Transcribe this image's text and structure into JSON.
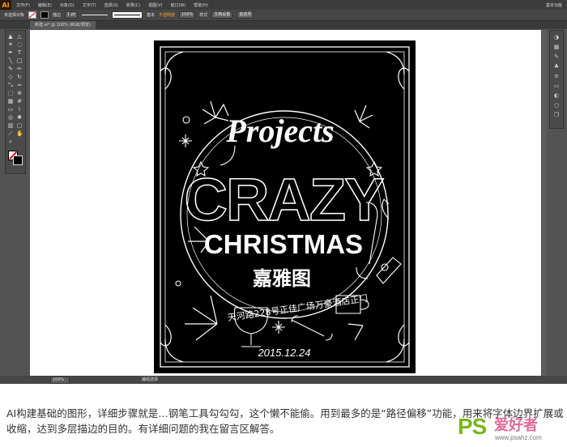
{
  "app": {
    "logo": "AI",
    "menu": [
      "文件(F)",
      "编辑(E)",
      "对象(O)",
      "文字(T)",
      "选择(S)",
      "效果(C)",
      "视图(V)",
      "窗口(W)",
      "帮助(H)"
    ],
    "workspace_label": "基本功能"
  },
  "control_bar": {
    "selection_label": "未选择对象",
    "stroke_label": "描边",
    "stroke_weight": "1 pt",
    "brush_label": "基本",
    "opacity_label": "不透明度",
    "opacity_value": "100%",
    "style_label": "样式",
    "doc_setup_button": "文档设置",
    "prefs_button": "首选项"
  },
  "document_tab": {
    "title": "新建.ai* @ 100% (RGB/预览)"
  },
  "status_bar": {
    "zoom": "100%",
    "mode": "编组选择"
  },
  "poster": {
    "script_word": "Projects",
    "headline": "CRAZY",
    "subhead": "CHRISTMAS",
    "chinese_name": "嘉雅图",
    "address": "天河路228号正佳广场万豪酒店正门",
    "date": "2015.12.24"
  },
  "caption": {
    "text": "AI构建基础的图形，详细步骤就是…钢笔工具勾勾勾，这个懒不能偷。用到最多的是“路径偏移”功能，用来将字体边界扩展或收缩，达到多层描边的目的。有详细问题的我在留言区解答。"
  },
  "watermark": {
    "ps": "PS",
    "love": "爱好者",
    "url": "www.psahz.com"
  },
  "colors": {
    "app_bg": "#535353",
    "menubar": "#3c3c3c",
    "accent_orange": "#f29b1e",
    "watermark_green": "#7ab51d",
    "watermark_pink": "#e06a9a"
  }
}
